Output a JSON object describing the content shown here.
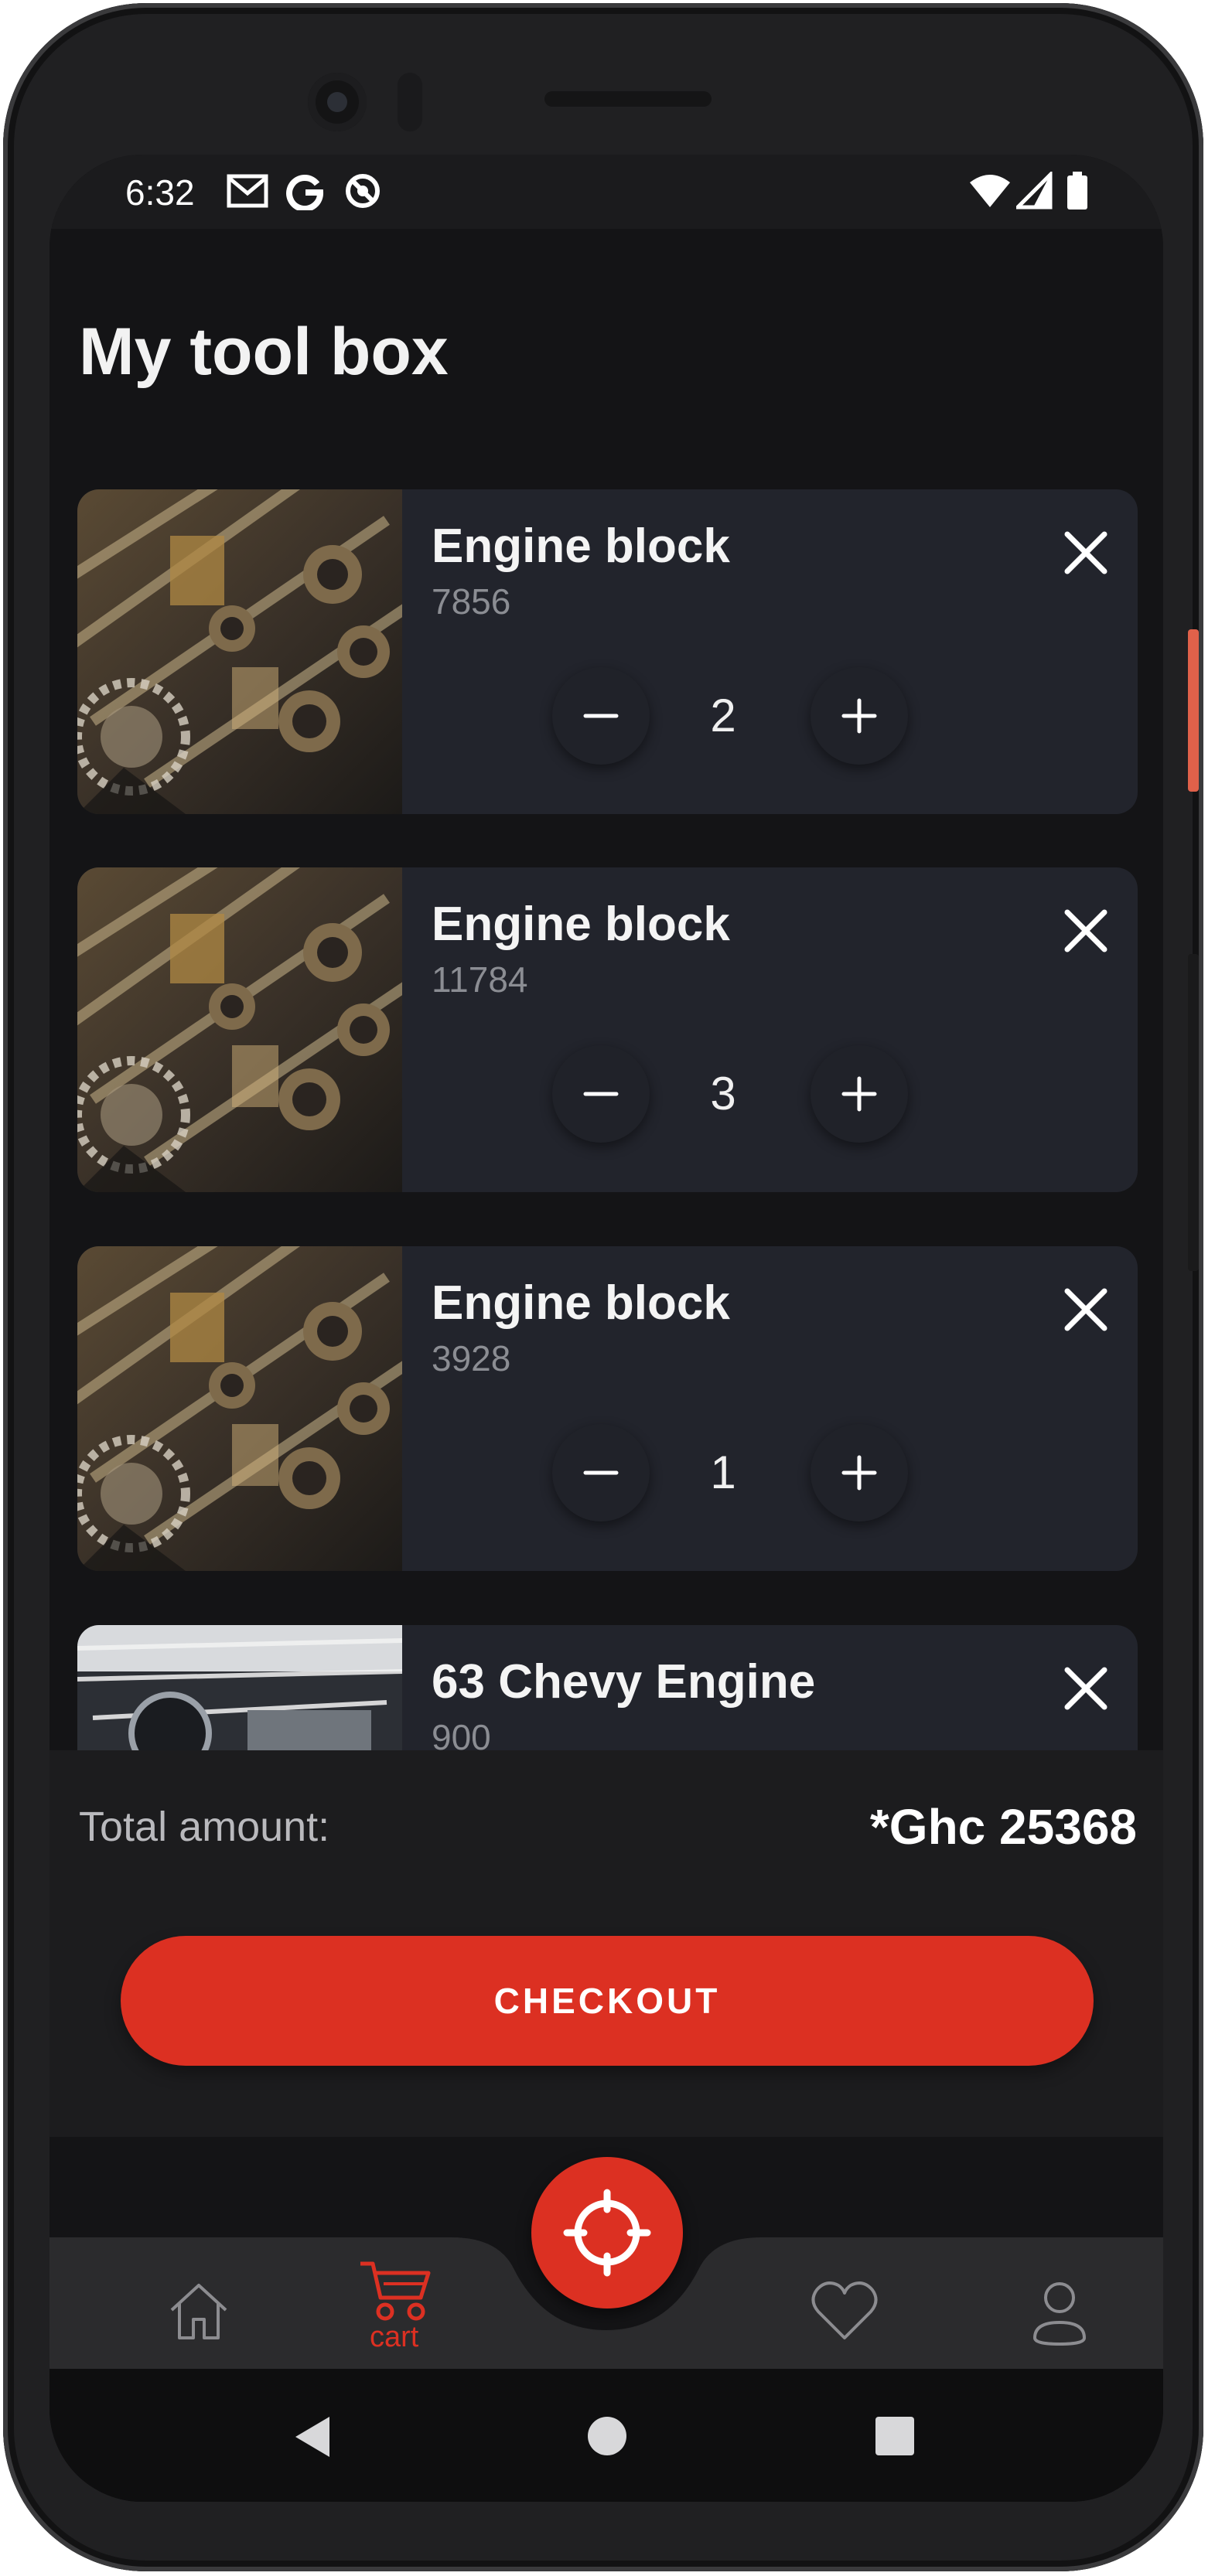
{
  "status_bar": {
    "time": "6:32",
    "left_icons": [
      "gmail-icon",
      "google-icon",
      "location-off-icon"
    ],
    "right_icons": [
      "wifi-icon",
      "cell-signal-icon",
      "battery-icon"
    ]
  },
  "page": {
    "title": "My tool box"
  },
  "cart_items": [
    {
      "name": "Engine block",
      "price": "7856",
      "quantity": "2",
      "image": "engine-photo"
    },
    {
      "name": "Engine block",
      "price": "11784",
      "quantity": "3",
      "image": "engine-photo"
    },
    {
      "name": "Engine block",
      "price": "3928",
      "quantity": "1",
      "image": "engine-photo"
    },
    {
      "name": "63 Chevy Engine",
      "price": "900",
      "quantity": "",
      "image": "chevy-engine-photo"
    }
  ],
  "summary": {
    "total_label": "Total amount:",
    "total_value": "*Ghc 25368",
    "checkout_label": "CHECKOUT"
  },
  "bottom_nav": {
    "items": [
      {
        "icon": "home-icon",
        "label": ""
      },
      {
        "icon": "cart-icon",
        "label": "cart",
        "active": true
      },
      {
        "icon": "heart-icon",
        "label": ""
      },
      {
        "icon": "user-icon",
        "label": ""
      }
    ],
    "fab_icon": "crosshair-icon"
  },
  "colors": {
    "accent": "#dc3022",
    "background": "#141416",
    "card": "#22242c",
    "muted_text": "#8b8d93"
  },
  "system_nav": [
    "back-icon",
    "home-circle-icon",
    "recents-icon"
  ]
}
